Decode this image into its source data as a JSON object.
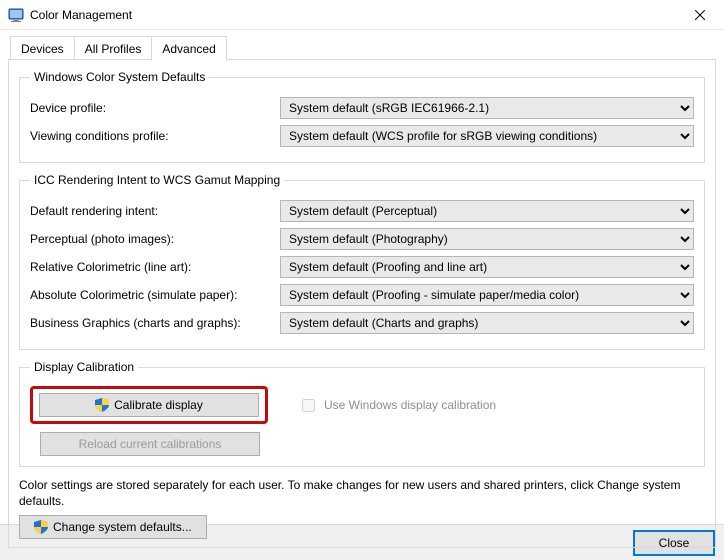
{
  "window": {
    "title": "Color Management"
  },
  "tabs": {
    "devices": "Devices",
    "all_profiles": "All Profiles",
    "advanced": "Advanced"
  },
  "group1": {
    "legend": "Windows Color System Defaults",
    "device_profile_label": "Device profile:",
    "device_profile_value": "System default (sRGB IEC61966-2.1)",
    "viewing_label": "Viewing conditions profile:",
    "viewing_value": "System default (WCS profile for sRGB viewing conditions)"
  },
  "group2": {
    "legend": "ICC Rendering Intent to WCS Gamut Mapping",
    "default_intent_label": "Default rendering intent:",
    "default_intent_value": "System default (Perceptual)",
    "perceptual_label": "Perceptual (photo images):",
    "perceptual_value": "System default (Photography)",
    "relative_label": "Relative Colorimetric (line art):",
    "relative_value": "System default (Proofing and line art)",
    "absolute_label": "Absolute Colorimetric (simulate paper):",
    "absolute_value": "System default (Proofing - simulate paper/media color)",
    "business_label": "Business Graphics (charts and graphs):",
    "business_value": "System default (Charts and graphs)"
  },
  "group3": {
    "legend": "Display Calibration",
    "calibrate_btn": "Calibrate display",
    "use_windows_label": "Use Windows display calibration",
    "reload_btn": "Reload current calibrations"
  },
  "note": "Color settings are stored separately for each user. To make changes for new users and shared printers, click Change system defaults.",
  "change_defaults_btn": "Change system defaults...",
  "footer": {
    "close": "Close"
  }
}
